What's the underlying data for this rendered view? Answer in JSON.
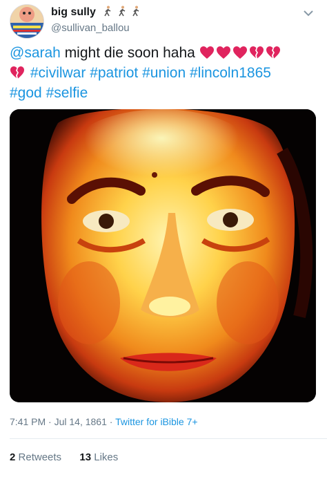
{
  "user": {
    "display_name": "big sully",
    "handle": "@sullivan_ballou",
    "name_emoji": [
      "man-walking-icon",
      "man-walking-icon",
      "man-walking-icon"
    ]
  },
  "tweet": {
    "mention": "@sarah",
    "text": " might die soon haha ",
    "hearts": [
      "red-heart",
      "red-heart",
      "red-heart",
      "broken-heart",
      "broken-heart",
      "broken-heart"
    ],
    "hashtags": [
      "#civilwar",
      "#patriot",
      "#union",
      "#lincoln1865",
      "#god",
      "#selfie"
    ]
  },
  "meta": {
    "time": "7:41 PM",
    "separator": "·",
    "date": "Jul 14, 1861",
    "app": "Twitter for iBible 7+"
  },
  "stats": {
    "retweets_count": "2",
    "retweets_label": "Retweets",
    "likes_count": "13",
    "likes_label": "Likes"
  },
  "colors": {
    "link": "#1b95e0",
    "muted": "#657786",
    "heart_red": "#e0245e"
  }
}
